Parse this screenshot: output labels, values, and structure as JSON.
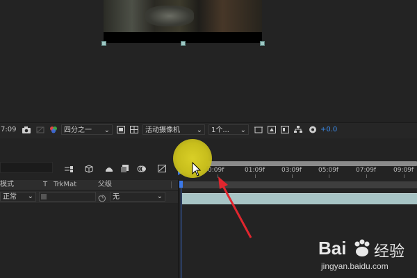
{
  "viewer_toolbar": {
    "timecode": "7:09",
    "resolution": "四分之一",
    "camera": "活动摄像机",
    "views": "1个...",
    "exposure": "+0.0"
  },
  "timeline": {
    "columns": {
      "mode": "模式",
      "t": "T",
      "trkmat": "TrkMat",
      "parent": "父级"
    },
    "layer": {
      "mode_value": "正常",
      "parent_value": "无"
    },
    "ruler_ticks": [
      "0:09f",
      "01:09f",
      "03:09f",
      "05:09f",
      "07:09f",
      "09:09f"
    ]
  },
  "watermark": {
    "brand": "Bai",
    "brand2": "经验",
    "url": "jingyan.baidu.com"
  },
  "colors": {
    "playhead": "#3b6fd6",
    "layer_bar": "#a7c4c5",
    "highlight": "#d9cf27",
    "annotation_arrow": "#e0262e"
  }
}
